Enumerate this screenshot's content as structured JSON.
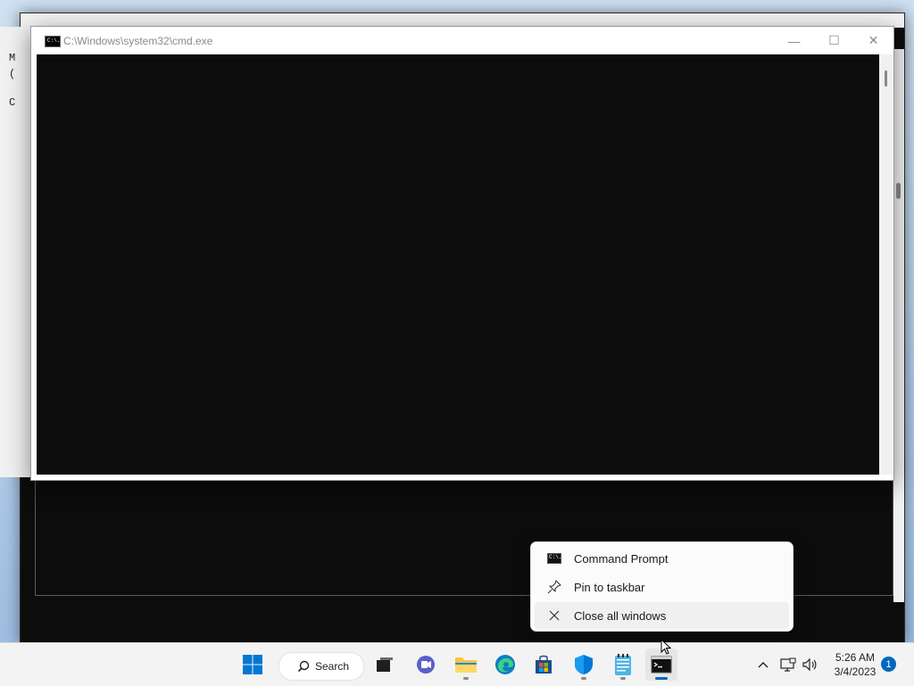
{
  "cmd_window": {
    "title": "C:\\Windows\\system32\\cmd.exe",
    "icon_text": "C:\\.",
    "minimize_glyph": "—",
    "maximize_glyph": "☐",
    "close_glyph": "✕"
  },
  "background_window": {
    "partial_lines": [
      "M",
      "(",
      "C"
    ]
  },
  "context_menu": {
    "items": [
      {
        "label": "Command Prompt",
        "icon": "command-prompt-icon"
      },
      {
        "label": "Pin to taskbar",
        "icon": "pin-icon"
      },
      {
        "label": "Close all windows",
        "icon": "close-icon"
      }
    ]
  },
  "taskbar": {
    "search_label": "Search",
    "apps": [
      {
        "name": "start",
        "icon": "windows-logo-icon"
      },
      {
        "name": "task-view",
        "icon": "task-view-icon"
      },
      {
        "name": "chat",
        "icon": "chat-icon"
      },
      {
        "name": "file-explorer",
        "icon": "folder-icon"
      },
      {
        "name": "edge",
        "icon": "edge-icon"
      },
      {
        "name": "store",
        "icon": "store-icon"
      },
      {
        "name": "defender",
        "icon": "shield-icon"
      },
      {
        "name": "notepad",
        "icon": "notepad-icon"
      },
      {
        "name": "command-prompt",
        "icon": "terminal-icon"
      }
    ],
    "time": "5:26 AM",
    "date": "3/4/2023",
    "notification_count": "1"
  },
  "colors": {
    "accent": "#0067c0",
    "console_bg": "#0c0c0c"
  }
}
